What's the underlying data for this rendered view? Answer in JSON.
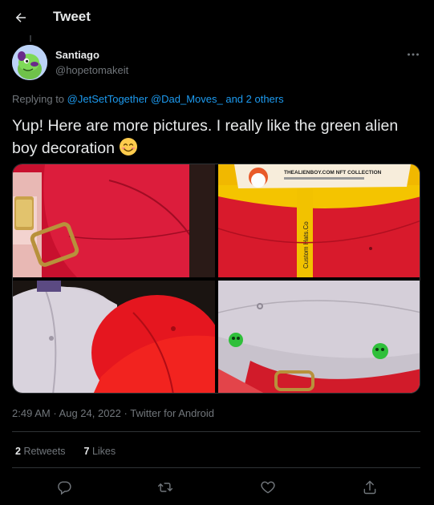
{
  "header": {
    "title": "Tweet"
  },
  "tweet": {
    "author": {
      "name": "Santiago",
      "handle": "@hopetomakeit"
    },
    "replying": {
      "prefix": "Replying to ",
      "mention1": "@JetSetTogether",
      "mention2": "@Dad_Moves_",
      "suffix": " and 2 others"
    },
    "text": "Yup! Here are more pictures. I really like the green alien boy decoration",
    "images": [
      {
        "label": ""
      },
      {
        "label": "THEALIENBOY.COM NFT COLLECTION",
        "strap": "Custom Hats.Co"
      },
      {
        "label": ""
      },
      {
        "label": ""
      }
    ],
    "time": "2:49 AM",
    "dot": " · ",
    "date": "Aug 24, 2022",
    "client": "Twitter for Android",
    "stats": {
      "retweets_count": "2",
      "retweets_label": "Retweets",
      "likes_count": "7",
      "likes_label": "Likes"
    }
  },
  "icons": {
    "back": "arrow-left-icon",
    "more": "more-horizontal-icon",
    "reply": "reply-icon",
    "retweet": "retweet-icon",
    "like": "heart-icon",
    "share": "share-icon",
    "emoji": "smiling-face-emoji"
  },
  "colors": {
    "background": "#000000",
    "text": "#e7e9ea",
    "secondary": "#71767b",
    "link": "#1d9bf0",
    "divider": "#2f3336"
  }
}
